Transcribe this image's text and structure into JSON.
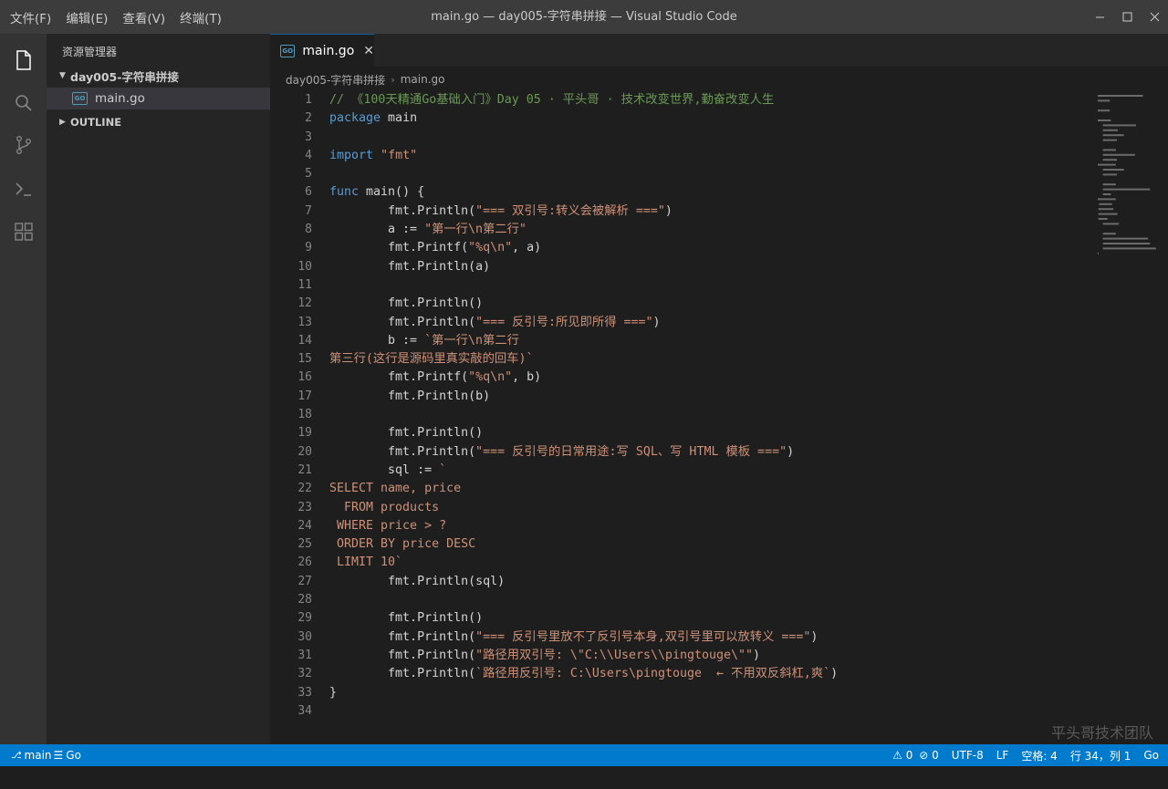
{
  "menu": [
    "文件(F)",
    "编辑(E)",
    "查看(V)",
    "终端(T)"
  ],
  "window_title": "main.go — day005-字符串拼接 — Visual Studio Code",
  "window_controls": {
    "minimize": "minimize-icon",
    "maximize": "maximize-icon",
    "close": "close-icon"
  },
  "activity_bar": [
    "files-icon",
    "search-icon",
    "source-control-icon",
    "terminal-icon",
    "extensions-icon"
  ],
  "sidebar": {
    "title": "资源管理器",
    "folder": "day005-字符串拼接",
    "file": "main.go",
    "file_badge": "GO",
    "outline": "OUTLINE"
  },
  "tab": {
    "label": "main.go",
    "badge": "GO"
  },
  "breadcrumb": [
    "day005-字符串拼接",
    "main.go"
  ],
  "colors": {
    "comment": "#6a9955",
    "keyword": "#569cd6",
    "string": "#ce9178",
    "text": "#d4d4d4",
    "statusbar": "#007acc"
  },
  "code_lines": [
    [
      {
        "t": "// 《100天精通Go基础入门》Day 05 · 平头哥 · 技术改变世界,勤奋改变人生",
        "c": "comment"
      }
    ],
    [
      {
        "t": "package",
        "c": "keyword"
      },
      {
        "t": " main",
        "c": "text"
      }
    ],
    [],
    [
      {
        "t": "import",
        "c": "keyword"
      },
      {
        "t": " ",
        "c": "text"
      },
      {
        "t": "\"fmt\"",
        "c": "string"
      }
    ],
    [],
    [
      {
        "t": "func",
        "c": "keyword"
      },
      {
        "t": " main() {",
        "c": "text"
      }
    ],
    [
      {
        "t": "        fmt.Println(",
        "c": "text"
      },
      {
        "t": "\"=== 双引号:转义会被解析 ===\"",
        "c": "string"
      },
      {
        "t": ")",
        "c": "text"
      }
    ],
    [
      {
        "t": "        a := ",
        "c": "text"
      },
      {
        "t": "\"第一行\\n第二行\"",
        "c": "string"
      }
    ],
    [
      {
        "t": "        fmt.Printf(",
        "c": "text"
      },
      {
        "t": "\"%q\\n\"",
        "c": "string"
      },
      {
        "t": ", a)",
        "c": "text"
      }
    ],
    [
      {
        "t": "        fmt.Println(a)",
        "c": "text"
      }
    ],
    [],
    [
      {
        "t": "        fmt.Println()",
        "c": "text"
      }
    ],
    [
      {
        "t": "        fmt.Println(",
        "c": "text"
      },
      {
        "t": "\"=== 反引号:所见即所得 ===\"",
        "c": "string"
      },
      {
        "t": ")",
        "c": "text"
      }
    ],
    [
      {
        "t": "        b := ",
        "c": "text"
      },
      {
        "t": "`第一行\\n第二行",
        "c": "string"
      }
    ],
    [
      {
        "t": "第三行(这行是源码里真实敲的回车)`",
        "c": "string"
      }
    ],
    [
      {
        "t": "        fmt.Printf(",
        "c": "text"
      },
      {
        "t": "\"%q\\n\"",
        "c": "string"
      },
      {
        "t": ", b)",
        "c": "text"
      }
    ],
    [
      {
        "t": "        fmt.Println(b)",
        "c": "text"
      }
    ],
    [],
    [
      {
        "t": "        fmt.Println()",
        "c": "text"
      }
    ],
    [
      {
        "t": "        fmt.Println(",
        "c": "text"
      },
      {
        "t": "\"=== 反引号的日常用途:写 SQL、写 HTML 模板 ===\"",
        "c": "string"
      },
      {
        "t": ")",
        "c": "text"
      }
    ],
    [
      {
        "t": "        sql := ",
        "c": "text"
      },
      {
        "t": "`",
        "c": "string"
      }
    ],
    [
      {
        "t": "SELECT name, price",
        "c": "string"
      }
    ],
    [
      {
        "t": "  FROM products",
        "c": "string"
      }
    ],
    [
      {
        "t": " WHERE price > ?",
        "c": "string"
      }
    ],
    [
      {
        "t": " ORDER BY price DESC",
        "c": "string"
      }
    ],
    [
      {
        "t": " LIMIT 10`",
        "c": "string"
      }
    ],
    [
      {
        "t": "        fmt.Println(sql)",
        "c": "text"
      }
    ],
    [],
    [
      {
        "t": "        fmt.Println()",
        "c": "text"
      }
    ],
    [
      {
        "t": "        fmt.Println(",
        "c": "text"
      },
      {
        "t": "\"=== 反引号里放不了反引号本身,双引号里可以放转义 ===\"",
        "c": "string"
      },
      {
        "t": ")",
        "c": "text"
      }
    ],
    [
      {
        "t": "        fmt.Println(",
        "c": "text"
      },
      {
        "t": "\"路径用双引号: \\\"C:\\\\Users\\\\pingtouge\\\"\"",
        "c": "string"
      },
      {
        "t": ")",
        "c": "text"
      }
    ],
    [
      {
        "t": "        fmt.Println(",
        "c": "text"
      },
      {
        "t": "`路径用反引号: C:\\Users\\pingtouge  ← 不用双反斜杠,爽`",
        "c": "string"
      },
      {
        "t": ")",
        "c": "text"
      }
    ],
    [
      {
        "t": "}",
        "c": "text"
      }
    ],
    []
  ],
  "watermark": "平头哥技术团队",
  "statusbar": {
    "branch": "main",
    "language_left": "Go",
    "warnings": "0",
    "errors": "0",
    "encoding": "UTF-8",
    "eol": "LF",
    "indent": "空格: 4",
    "position": "行 34，列 1",
    "language": "Go"
  }
}
